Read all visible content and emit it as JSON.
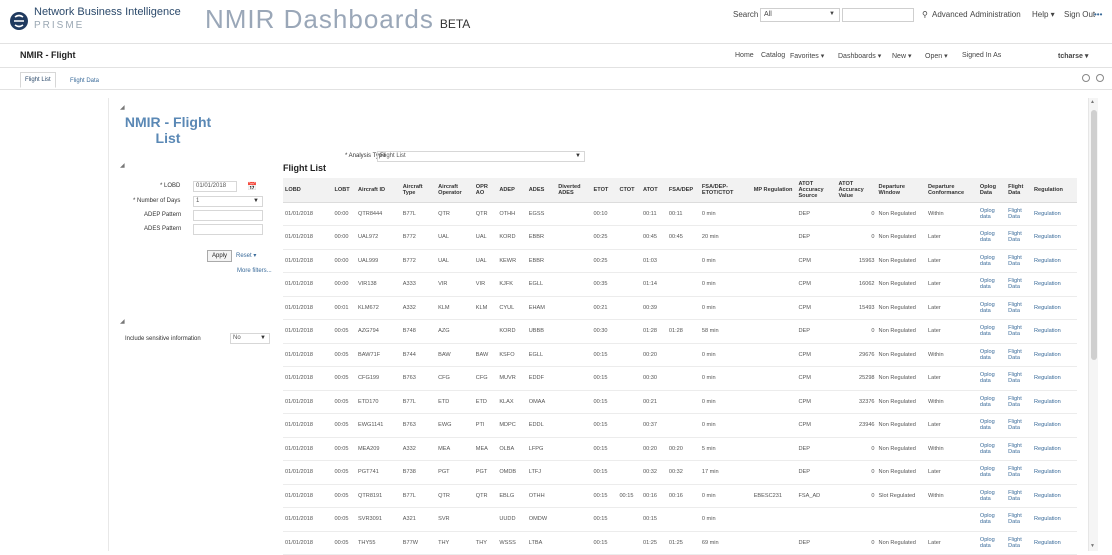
{
  "header": {
    "brand_name": "Network Business Intelligence",
    "brand_sub": "PRISME",
    "app_title": "NMIR Dashboards",
    "app_beta": "BETA",
    "search_label": "Search",
    "search_scope": "All",
    "advanced": "Advanced",
    "administration": "Administration",
    "help": "Help ▾",
    "sign_out": "Sign Out"
  },
  "subbar": {
    "page_title": "NMIR - Flight",
    "home": "Home",
    "catalog": "Catalog",
    "favorites": "Favorites ▾",
    "dashboards": "Dashboards ▾",
    "new": "New ▾",
    "open": "Open ▾",
    "signed_in_as": "Signed In As",
    "user": "tcharse ▾"
  },
  "tabs": [
    {
      "label": "Flight List"
    },
    {
      "label": "Flight Data"
    }
  ],
  "report": {
    "title_line1": "NMIR - Flight",
    "title_line2": "List",
    "analysis_type_label": "* Analysis Type",
    "analysis_type_value": "Flight List"
  },
  "filters": {
    "lobd_label": "* LOBD",
    "lobd_value": "01/01/2018",
    "days_label": "* Number of Days",
    "days_value": "1",
    "adep_label": "ADEP Pattern",
    "ades_label": "ADES Pattern",
    "apply": "Apply",
    "reset": "Reset ▾",
    "more": "More filters...",
    "sensitive_label": "Include sensitive information",
    "sensitive_value": "No"
  },
  "table": {
    "title": "Flight List",
    "columns": [
      "LOBD",
      "LOBT",
      "Aircraft ID",
      "Aircraft Type",
      "Aircraft Operator",
      "OPR AO",
      "ADEP",
      "ADES",
      "Diverted ADES",
      "ETOT",
      "CTOT",
      "ATOT",
      "FSA/DEP",
      "FSA/DEP- ETOT/CTOT",
      "MP Regulation",
      "ATOT Accuracy Source",
      "ATOT Accuracy Value",
      "Departure Window",
      "Departure Conformance",
      "Oplog Data",
      "Flight Data",
      "Regulation"
    ],
    "rows": [
      [
        "01/01/2018",
        "00:00",
        "QTR8444",
        "B77L",
        "QTR",
        "QTR",
        "OTHH",
        "EGSS",
        "",
        "00:10",
        "",
        "00:11",
        "00:11",
        "0 min",
        "",
        "DEP",
        "0",
        "Non Regulated",
        "Within",
        "Oplog data",
        "Flight Data",
        "Regulation"
      ],
      [
        "01/01/2018",
        "00:00",
        "UAL972",
        "B772",
        "UAL",
        "UAL",
        "KORD",
        "EBBR",
        "",
        "00:25",
        "",
        "00:45",
        "00:45",
        "20 min",
        "",
        "DEP",
        "0",
        "Non Regulated",
        "Later",
        "Oplog data",
        "Flight Data",
        "Regulation"
      ],
      [
        "01/01/2018",
        "00:00",
        "UAL999",
        "B772",
        "UAL",
        "UAL",
        "KEWR",
        "EBBR",
        "",
        "00:25",
        "",
        "01:03",
        "",
        "0 min",
        "",
        "CPM",
        "15963",
        "Non Regulated",
        "Later",
        "Oplog data",
        "Flight Data",
        "Regulation"
      ],
      [
        "01/01/2018",
        "00:00",
        "VIR138",
        "A333",
        "VIR",
        "VIR",
        "KJFK",
        "EGLL",
        "",
        "00:35",
        "",
        "01:14",
        "",
        "0 min",
        "",
        "CPM",
        "16062",
        "Non Regulated",
        "Later",
        "Oplog data",
        "Flight Data",
        "Regulation"
      ],
      [
        "01/01/2018",
        "00:01",
        "KLM672",
        "A332",
        "KLM",
        "KLM",
        "CYUL",
        "EHAM",
        "",
        "00:21",
        "",
        "00:39",
        "",
        "0 min",
        "",
        "CPM",
        "15493",
        "Non Regulated",
        "Later",
        "Oplog data",
        "Flight Data",
        "Regulation"
      ],
      [
        "01/01/2018",
        "00:05",
        "AZG794",
        "B748",
        "AZG",
        "",
        "KORD",
        "UBBB",
        "",
        "00:30",
        "",
        "01:28",
        "01:28",
        "58 min",
        "",
        "DEP",
        "0",
        "Non Regulated",
        "Later",
        "Oplog data",
        "Flight Data",
        "Regulation"
      ],
      [
        "01/01/2018",
        "00:05",
        "BAW71F",
        "B744",
        "BAW",
        "BAW",
        "KSFO",
        "EGLL",
        "",
        "00:15",
        "",
        "00:20",
        "",
        "0 min",
        "",
        "CPM",
        "29676",
        "Non Regulated",
        "Within",
        "Oplog data",
        "Flight Data",
        "Regulation"
      ],
      [
        "01/01/2018",
        "00:05",
        "CFG199",
        "B763",
        "CFG",
        "CFG",
        "MUVR",
        "EDDF",
        "",
        "00:15",
        "",
        "00:30",
        "",
        "0 min",
        "",
        "CPM",
        "25298",
        "Non Regulated",
        "Later",
        "Oplog data",
        "Flight Data",
        "Regulation"
      ],
      [
        "01/01/2018",
        "00:05",
        "ETD170",
        "B77L",
        "ETD",
        "ETD",
        "KLAX",
        "OMAA",
        "",
        "00:15",
        "",
        "00:21",
        "",
        "0 min",
        "",
        "CPM",
        "32376",
        "Non Regulated",
        "Within",
        "Oplog data",
        "Flight Data",
        "Regulation"
      ],
      [
        "01/01/2018",
        "00:05",
        "EWG1141",
        "B763",
        "EWG",
        "PTI",
        "MDPC",
        "EDDL",
        "",
        "00:15",
        "",
        "00:37",
        "",
        "0 min",
        "",
        "CPM",
        "23946",
        "Non Regulated",
        "Later",
        "Oplog data",
        "Flight Data",
        "Regulation"
      ],
      [
        "01/01/2018",
        "00:05",
        "MEA209",
        "A332",
        "MEA",
        "MEA",
        "OLBA",
        "LFPG",
        "",
        "00:15",
        "",
        "00:20",
        "00:20",
        "5 min",
        "",
        "DEP",
        "0",
        "Non Regulated",
        "Within",
        "Oplog data",
        "Flight Data",
        "Regulation"
      ],
      [
        "01/01/2018",
        "00:05",
        "PGT741",
        "B738",
        "PGT",
        "PGT",
        "OMDB",
        "LTFJ",
        "",
        "00:15",
        "",
        "00:32",
        "00:32",
        "17 min",
        "",
        "DEP",
        "0",
        "Non Regulated",
        "Later",
        "Oplog data",
        "Flight Data",
        "Regulation"
      ],
      [
        "01/01/2018",
        "00:05",
        "QTR8191",
        "B77L",
        "QTR",
        "QTR",
        "EBLG",
        "OTHH",
        "",
        "00:15",
        "00:15",
        "00:16",
        "00:16",
        "0 min",
        "EBESC231",
        "FSA_AD",
        "0",
        "Slot Regulated",
        "Within",
        "Oplog data",
        "Flight Data",
        "Regulation"
      ],
      [
        "01/01/2018",
        "00:05",
        "SVR3091",
        "A321",
        "SVR",
        "",
        "UUDD",
        "OMDW",
        "",
        "00:15",
        "",
        "00:15",
        "",
        "0 min",
        "",
        "",
        "",
        "",
        "",
        "Oplog data",
        "Flight Data",
        "Regulation"
      ],
      [
        "01/01/2018",
        "00:05",
        "THY55",
        "B77W",
        "THY",
        "THY",
        "WSSS",
        "LTBA",
        "",
        "00:15",
        "",
        "01:25",
        "01:25",
        "69 min",
        "",
        "DEP",
        "0",
        "Non Regulated",
        "Later",
        "Oplog data",
        "Flight Data",
        "Regulation"
      ]
    ]
  },
  "colors": {
    "accent": "#5a88b5",
    "link": "#3a6b9a"
  }
}
